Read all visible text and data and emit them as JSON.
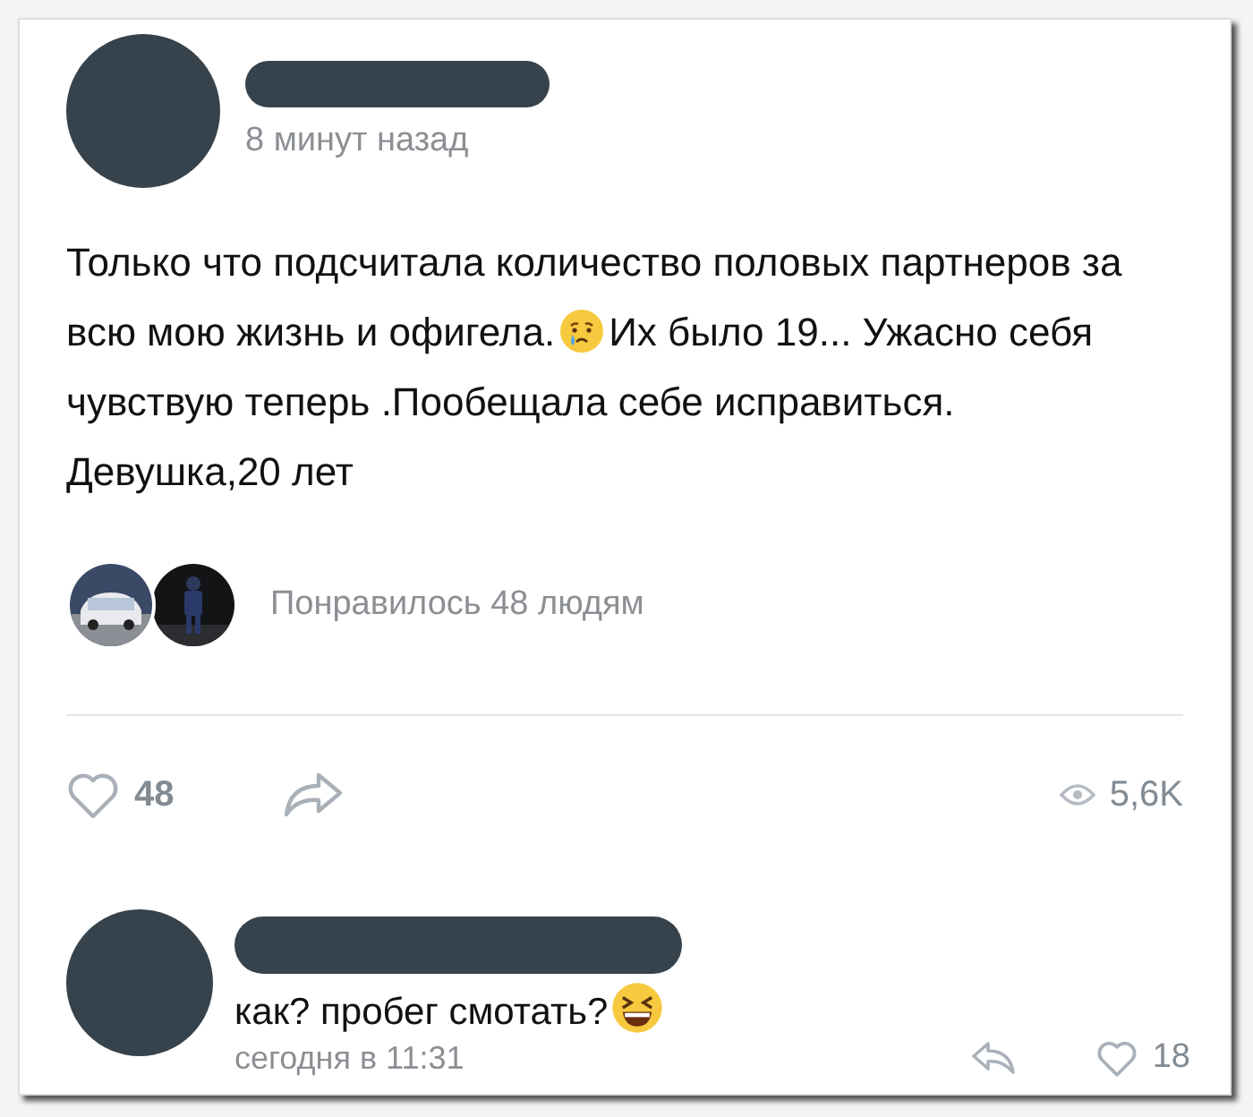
{
  "post": {
    "time": "8 минут назад",
    "text": [
      {
        "kind": "text",
        "value": "Только что подсчитала количество половых партнеров за всю мою жизнь и офигела."
      },
      {
        "kind": "crying"
      },
      {
        "kind": "text",
        "value": "Их было 19... Ужасно себя чувствую теперь .Пообещала себе исправиться. Девушка,20 лет"
      }
    ],
    "likes_text": "Понравилось 48 людям",
    "like_count": "48",
    "views": "5,6K"
  },
  "comment": {
    "text": [
      {
        "kind": "text",
        "value": "как? пробег смотать?"
      },
      {
        "kind": "laughing"
      }
    ],
    "time": "сегодня в 11:31",
    "like_count": "18"
  }
}
